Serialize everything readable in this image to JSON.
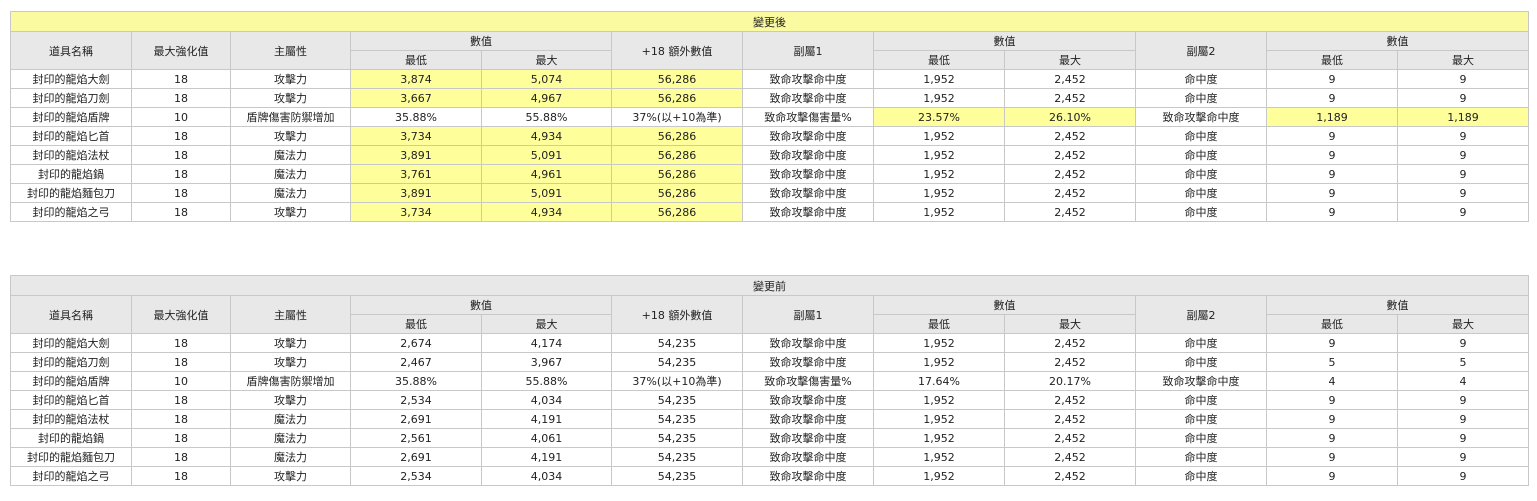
{
  "colors": {
    "highlight": "#fefe9a",
    "title_after_bg": "#fafaa0",
    "header_bg": "#e8e8e8"
  },
  "headers": {
    "item_name": "道具名稱",
    "max_enhance": "最大強化值",
    "main_attr": "主屬性",
    "value_group": "數值",
    "min": "最低",
    "max": "最大",
    "extra18": "+18 額外數值",
    "sub1": "副屬1",
    "sub2": "副屬2"
  },
  "tables": [
    {
      "title": "變更後",
      "rows": [
        {
          "name": "封印的龍焰大劍",
          "enh": "18",
          "attr": "攻擊力",
          "min": "3,874",
          "max": "5,074",
          "extra": "56,286",
          "sub1": "致命攻擊命中度",
          "s1min": "1,952",
          "s1max": "2,452",
          "sub2": "命中度",
          "s2min": "9",
          "s2max": "9",
          "hl": [
            1,
            1,
            1,
            0,
            0,
            0,
            0
          ]
        },
        {
          "name": "封印的龍焰刀劍",
          "enh": "18",
          "attr": "攻擊力",
          "min": "3,667",
          "max": "4,967",
          "extra": "56,286",
          "sub1": "致命攻擊命中度",
          "s1min": "1,952",
          "s1max": "2,452",
          "sub2": "命中度",
          "s2min": "9",
          "s2max": "9",
          "hl": [
            1,
            1,
            1,
            0,
            0,
            0,
            0
          ]
        },
        {
          "name": "封印的龍焰盾牌",
          "enh": "10",
          "attr": "盾牌傷害防禦增加",
          "min": "35.88%",
          "max": "55.88%",
          "extra": "37%(以+10為準)",
          "sub1": "致命攻擊傷害量%",
          "s1min": "23.57%",
          "s1max": "26.10%",
          "sub2": "致命攻擊命中度",
          "s2min": "1,189",
          "s2max": "1,189",
          "hl": [
            0,
            0,
            0,
            1,
            1,
            1,
            1
          ]
        },
        {
          "name": "封印的龍焰匕首",
          "enh": "18",
          "attr": "攻擊力",
          "min": "3,734",
          "max": "4,934",
          "extra": "56,286",
          "sub1": "致命攻擊命中度",
          "s1min": "1,952",
          "s1max": "2,452",
          "sub2": "命中度",
          "s2min": "9",
          "s2max": "9",
          "hl": [
            1,
            1,
            1,
            0,
            0,
            0,
            0
          ]
        },
        {
          "name": "封印的龍焰法杖",
          "enh": "18",
          "attr": "魔法力",
          "min": "3,891",
          "max": "5,091",
          "extra": "56,286",
          "sub1": "致命攻擊命中度",
          "s1min": "1,952",
          "s1max": "2,452",
          "sub2": "命中度",
          "s2min": "9",
          "s2max": "9",
          "hl": [
            1,
            1,
            1,
            0,
            0,
            0,
            0
          ]
        },
        {
          "name": "封印的龍焰鍋",
          "enh": "18",
          "attr": "魔法力",
          "min": "3,761",
          "max": "4,961",
          "extra": "56,286",
          "sub1": "致命攻擊命中度",
          "s1min": "1,952",
          "s1max": "2,452",
          "sub2": "命中度",
          "s2min": "9",
          "s2max": "9",
          "hl": [
            1,
            1,
            1,
            0,
            0,
            0,
            0
          ]
        },
        {
          "name": "封印的龍焰麵包刀",
          "enh": "18",
          "attr": "魔法力",
          "min": "3,891",
          "max": "5,091",
          "extra": "56,286",
          "sub1": "致命攻擊命中度",
          "s1min": "1,952",
          "s1max": "2,452",
          "sub2": "命中度",
          "s2min": "9",
          "s2max": "9",
          "hl": [
            1,
            1,
            1,
            0,
            0,
            0,
            0
          ]
        },
        {
          "name": "封印的龍焰之弓",
          "enh": "18",
          "attr": "攻擊力",
          "min": "3,734",
          "max": "4,934",
          "extra": "56,286",
          "sub1": "致命攻擊命中度",
          "s1min": "1,952",
          "s1max": "2,452",
          "sub2": "命中度",
          "s2min": "9",
          "s2max": "9",
          "hl": [
            1,
            1,
            1,
            0,
            0,
            0,
            0
          ]
        }
      ]
    },
    {
      "title": "變更前",
      "rows": [
        {
          "name": "封印的龍焰大劍",
          "enh": "18",
          "attr": "攻擊力",
          "min": "2,674",
          "max": "4,174",
          "extra": "54,235",
          "sub1": "致命攻擊命中度",
          "s1min": "1,952",
          "s1max": "2,452",
          "sub2": "命中度",
          "s2min": "9",
          "s2max": "9",
          "hl": [
            0,
            0,
            0,
            0,
            0,
            0,
            0
          ]
        },
        {
          "name": "封印的龍焰刀劍",
          "enh": "18",
          "attr": "攻擊力",
          "min": "2,467",
          "max": "3,967",
          "extra": "54,235",
          "sub1": "致命攻擊命中度",
          "s1min": "1,952",
          "s1max": "2,452",
          "sub2": "命中度",
          "s2min": "5",
          "s2max": "5",
          "hl": [
            0,
            0,
            0,
            0,
            0,
            0,
            0
          ]
        },
        {
          "name": "封印的龍焰盾牌",
          "enh": "10",
          "attr": "盾牌傷害防禦增加",
          "min": "35.88%",
          "max": "55.88%",
          "extra": "37%(以+10為準)",
          "sub1": "致命攻擊傷害量%",
          "s1min": "17.64%",
          "s1max": "20.17%",
          "sub2": "致命攻擊命中度",
          "s2min": "4",
          "s2max": "4",
          "hl": [
            0,
            0,
            0,
            0,
            0,
            0,
            0
          ]
        },
        {
          "name": "封印的龍焰匕首",
          "enh": "18",
          "attr": "攻擊力",
          "min": "2,534",
          "max": "4,034",
          "extra": "54,235",
          "sub1": "致命攻擊命中度",
          "s1min": "1,952",
          "s1max": "2,452",
          "sub2": "命中度",
          "s2min": "9",
          "s2max": "9",
          "hl": [
            0,
            0,
            0,
            0,
            0,
            0,
            0
          ]
        },
        {
          "name": "封印的龍焰法杖",
          "enh": "18",
          "attr": "魔法力",
          "min": "2,691",
          "max": "4,191",
          "extra": "54,235",
          "sub1": "致命攻擊命中度",
          "s1min": "1,952",
          "s1max": "2,452",
          "sub2": "命中度",
          "s2min": "9",
          "s2max": "9",
          "hl": [
            0,
            0,
            0,
            0,
            0,
            0,
            0
          ]
        },
        {
          "name": "封印的龍焰鍋",
          "enh": "18",
          "attr": "魔法力",
          "min": "2,561",
          "max": "4,061",
          "extra": "54,235",
          "sub1": "致命攻擊命中度",
          "s1min": "1,952",
          "s1max": "2,452",
          "sub2": "命中度",
          "s2min": "9",
          "s2max": "9",
          "hl": [
            0,
            0,
            0,
            0,
            0,
            0,
            0
          ]
        },
        {
          "name": "封印的龍焰麵包刀",
          "enh": "18",
          "attr": "魔法力",
          "min": "2,691",
          "max": "4,191",
          "extra": "54,235",
          "sub1": "致命攻擊命中度",
          "s1min": "1,952",
          "s1max": "2,452",
          "sub2": "命中度",
          "s2min": "9",
          "s2max": "9",
          "hl": [
            0,
            0,
            0,
            0,
            0,
            0,
            0
          ]
        },
        {
          "name": "封印的龍焰之弓",
          "enh": "18",
          "attr": "攻擊力",
          "min": "2,534",
          "max": "4,034",
          "extra": "54,235",
          "sub1": "致命攻擊命中度",
          "s1min": "1,952",
          "s1max": "2,452",
          "sub2": "命中度",
          "s2min": "9",
          "s2max": "9",
          "hl": [
            0,
            0,
            0,
            0,
            0,
            0,
            0
          ]
        }
      ]
    }
  ]
}
